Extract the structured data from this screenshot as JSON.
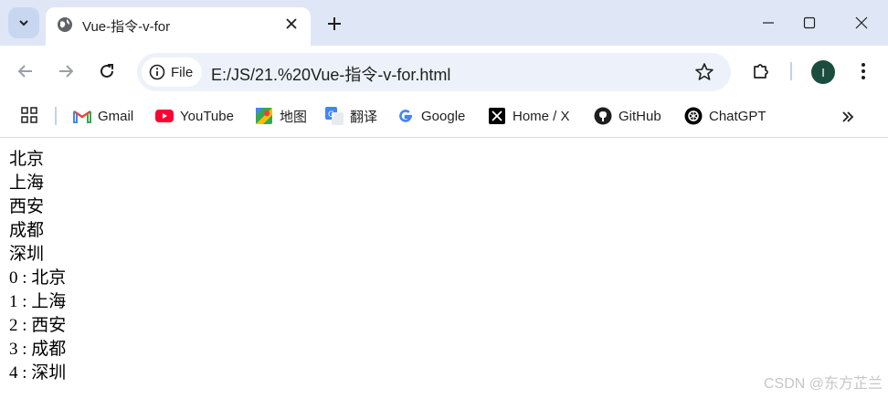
{
  "browser": {
    "tab": {
      "title": "Vue-指令-v-for"
    },
    "window_controls": {
      "minimize": "minimize",
      "maximize": "maximize",
      "close": "close"
    },
    "address": {
      "chip_label": "File",
      "url": "E:/JS/21.%20Vue-指令-v-for.html"
    },
    "profile_initial": "I",
    "bookmarks": [
      {
        "label": "Gmail",
        "icon": "gmail-icon"
      },
      {
        "label": "YouTube",
        "icon": "youtube-icon"
      },
      {
        "label": "地图",
        "icon": "maps-icon"
      },
      {
        "label": "翻译",
        "icon": "translate-icon"
      },
      {
        "label": "Google",
        "icon": "google-icon"
      },
      {
        "label": "Home / X",
        "icon": "x-icon"
      },
      {
        "label": "GitHub",
        "icon": "github-icon"
      },
      {
        "label": "ChatGPT",
        "icon": "chatgpt-icon"
      }
    ]
  },
  "page": {
    "cities": [
      "北京",
      "上海",
      "西安",
      "成都",
      "深圳"
    ],
    "indexed": [
      "0 : 北京",
      "1 : 上海",
      "2 : 西安",
      "3 : 成都",
      "4 : 深圳"
    ]
  },
  "watermark": "CSDN @东方芷兰",
  "colors": {
    "chrome_bg": "#dfe7f6",
    "omnibox_bg": "#edf2fa",
    "avatar_bg": "#1b4d3e"
  }
}
